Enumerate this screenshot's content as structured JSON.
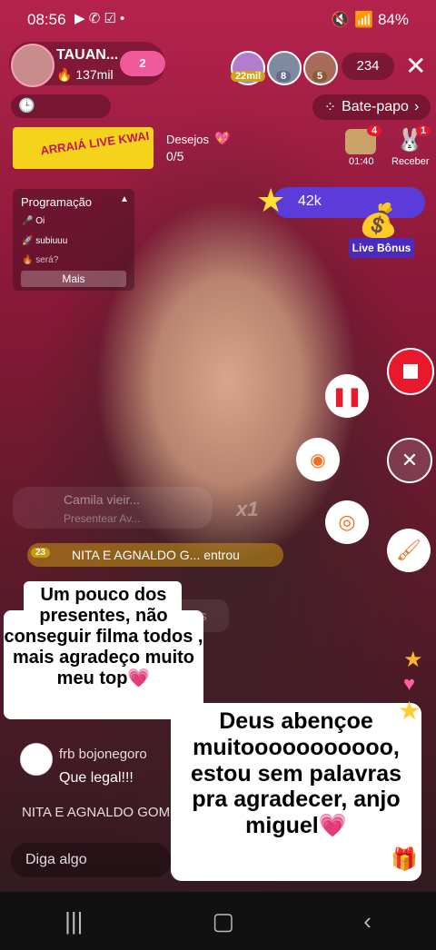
{
  "status_bar": {
    "time": "08:56",
    "right": "🔇 📶 84%"
  },
  "host": {
    "name": "TAUAN...",
    "likes": "137mil",
    "level": "2"
  },
  "viewers": {
    "badge1": "22mil",
    "badge2": "8",
    "badge3": "5",
    "count": "234"
  },
  "chat_button": "Bate-papo",
  "banner": {
    "text": "ARRAIÁ LIVE KWAI",
    "wishes_label": "Desejos",
    "wishes_value": "0/5"
  },
  "rewards": {
    "timer": "01:40",
    "timer_badge": "4",
    "receive": "Receber",
    "receive_badge": "1"
  },
  "schedule": {
    "title": "Programação",
    "items": [
      "Oi",
      "subiuuu",
      "será?"
    ],
    "more": "Mais"
  },
  "live_bonus": {
    "count": "42k",
    "label": "Live Bônus"
  },
  "overlays": {
    "camila": "Camila vieir...",
    "camila_sub": "Presentear Av...",
    "gift_x": "x1",
    "entrou_level": "23",
    "entrou": "NITA E AGNALDO G... entrou",
    "edits": "edits"
  },
  "caption1": "Um pouco dos presentes, não conseguir filma todos , mais agradeço muito meu top💗",
  "caption2": "Deus abençoe muitooooooooooo, estou sem palavras pra agradecer, anjo miguel💗",
  "chat": {
    "user": "frb bojonegoro",
    "message": "Que legal!!!",
    "ticker": "NITA E AGNALDO GOM"
  },
  "input": {
    "placeholder": "Diga algo"
  },
  "colors": {
    "accent": "#e8192c",
    "pink": "#f04b8c",
    "purple": "#5b3bd9"
  }
}
